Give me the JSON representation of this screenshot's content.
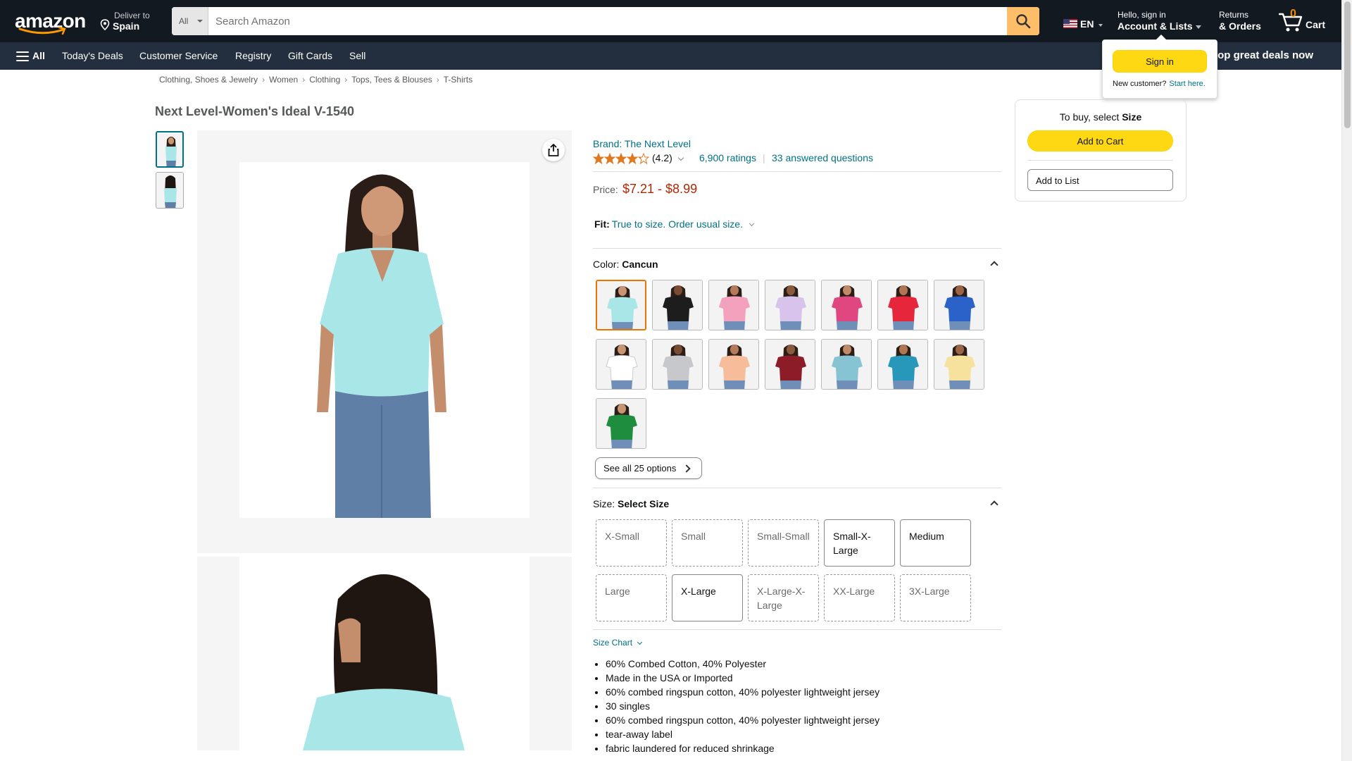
{
  "header": {
    "logo_text": "amazon",
    "deliver_label": "Deliver to",
    "deliver_location": "Spain",
    "search_category": "All",
    "search_placeholder": "Search Amazon",
    "language": "EN",
    "account_greeting": "Hello, sign in",
    "account_label": "Account & Lists",
    "returns_label": "Returns",
    "orders_label": "& Orders",
    "cart_count": "0",
    "cart_label": "Cart"
  },
  "subnav": {
    "all_label": "All",
    "items": [
      "Today's Deals",
      "Customer Service",
      "Registry",
      "Gift Cards",
      "Sell"
    ],
    "promo": "Shop great deals now"
  },
  "signin_flyout": {
    "button": "Sign in",
    "new_customer": "New customer?",
    "start_here": "Start here."
  },
  "breadcrumb": [
    "Clothing, Shoes & Jewelry",
    "Women",
    "Clothing",
    "Tops, Tees & Blouses",
    "T-Shirts"
  ],
  "product": {
    "title": "Next Level-Women's Ideal V-1540",
    "brand": "Brand: The Next Level",
    "rating": "(4.2)",
    "rating_value": 4.2,
    "ratings_count": "6,900 ratings",
    "questions": "33 answered questions",
    "price_label": "Price:",
    "price": "$7.21 - $8.99",
    "fit_label": "Fit:",
    "fit_value": "True to size. Order usual size.",
    "color_label": "Color:",
    "color_selected": "Cancun",
    "see_all": "See all 25 options",
    "size_label": "Size:",
    "size_selected": "Select Size",
    "size_chart": "Size Chart",
    "bullets": [
      "60% Combed Cotton, 40% Polyester",
      "Made in the USA or Imported",
      "60% combed ringspun cotton, 40% polyester lightweight jersey",
      "30 singles",
      "60% combed ringspun cotton, 40% polyester lightweight jersey",
      "tear-away label",
      "fabric laundered for reduced shrinkage"
    ]
  },
  "colors": [
    {
      "shirt": "#a8e6e8",
      "selected": true
    },
    {
      "shirt": "#1d1d1d"
    },
    {
      "shirt": "#f3a1bd"
    },
    {
      "shirt": "#d7c3ec"
    },
    {
      "shirt": "#e0467f"
    },
    {
      "shirt": "#e5263b"
    },
    {
      "shirt": "#2a62c9"
    },
    {
      "shirt": "#ffffff"
    },
    {
      "shirt": "#c6c8cb"
    },
    {
      "shirt": "#f7bd9b"
    },
    {
      "shirt": "#8c1d28"
    },
    {
      "shirt": "#86c4d3"
    },
    {
      "shirt": "#2798b9"
    },
    {
      "shirt": "#f6e29c"
    },
    {
      "shirt": "#1e8e3e"
    }
  ],
  "sizes": [
    {
      "label": "X-Small",
      "available": false
    },
    {
      "label": "Small",
      "available": false
    },
    {
      "label": "Small-Small",
      "available": false
    },
    {
      "label": "Small-X-Large",
      "available": true
    },
    {
      "label": "Medium",
      "available": true
    },
    {
      "label": "Large",
      "available": false
    },
    {
      "label": "X-Large",
      "available": true
    },
    {
      "label": "X-Large-X-Large",
      "available": false
    },
    {
      "label": "XX-Large",
      "available": false
    },
    {
      "label": "3X-Large",
      "available": false
    }
  ],
  "buybox": {
    "to_buy": "To buy, select",
    "to_buy_bold": "Size",
    "add_to_cart": "Add to Cart",
    "add_to_list": "Add to List"
  },
  "colors_theme": {
    "nav_dark": "#131921",
    "nav_sub": "#232F3E",
    "accent_yellow": "#FFD814",
    "link": "#007185",
    "price": "#B12704"
  }
}
